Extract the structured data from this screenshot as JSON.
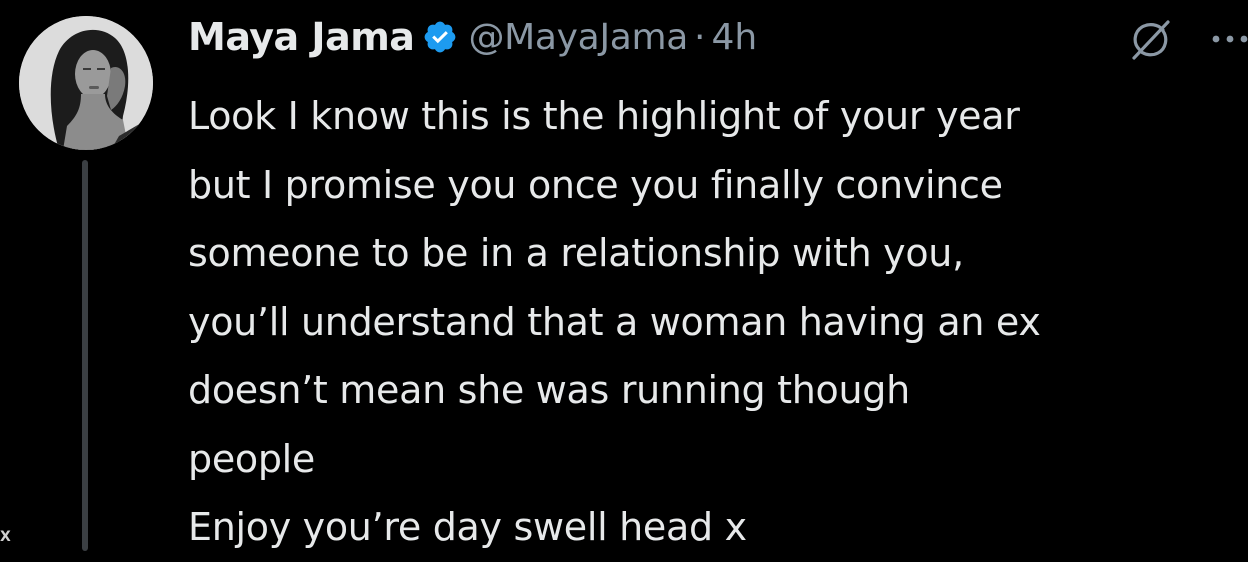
{
  "tweet": {
    "display_name": "Maya Jama",
    "verified": true,
    "handle": "@MayaJama",
    "separator": "·",
    "time": "4h",
    "lines": [
      "Look I know this is the highlight of your year",
      "but I promise you once you finally convince",
      "someone to be in a relationship with you,",
      "you’ll understand that a woman having an ex",
      "doesn’t mean she was running though",
      "people",
      "Enjoy you’re day swell head x"
    ]
  },
  "watermark": "X",
  "icons": {
    "verified": "verified-badge-icon",
    "grok": "grok-icon",
    "more": "more-icon",
    "avatar": "avatar"
  },
  "colors": {
    "background": "#000000",
    "text": "#e7e9ea",
    "secondary": "#8b98a5",
    "verified": "#1d9bf0"
  }
}
